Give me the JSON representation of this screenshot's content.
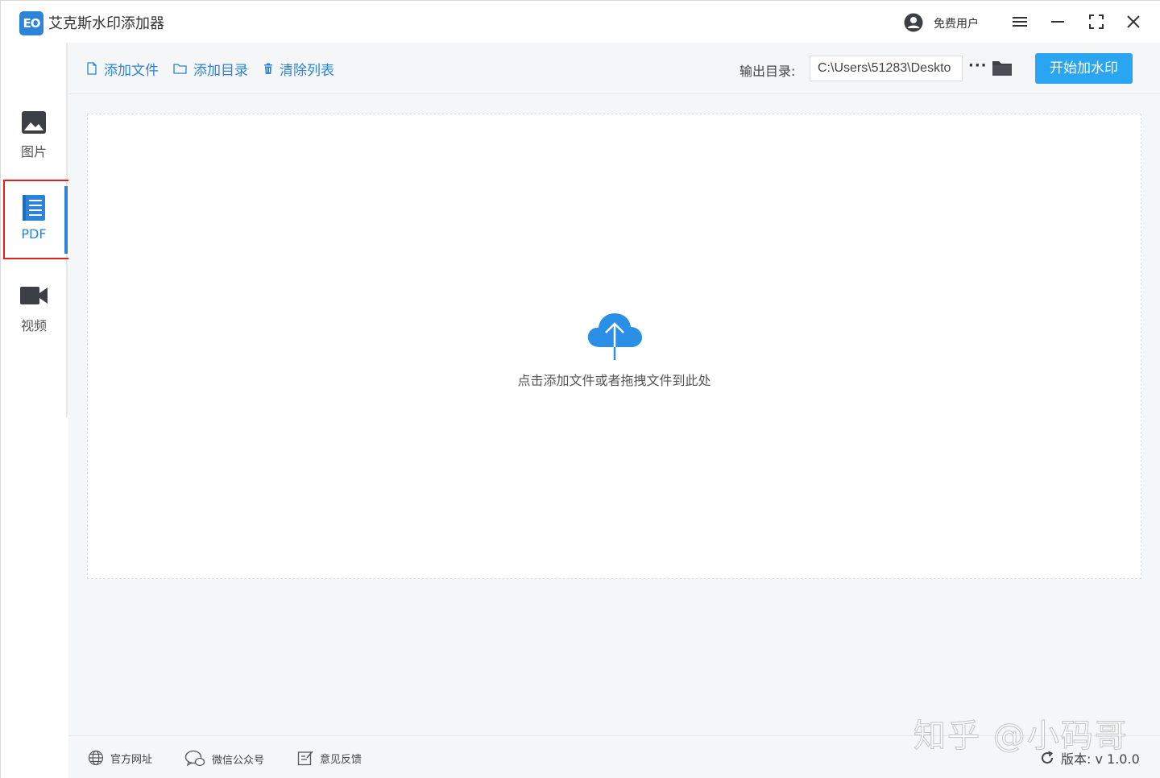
{
  "app": {
    "title": "艾克斯水印添加器",
    "logo_text": "EO",
    "user_label": "免费用户"
  },
  "sidebar": {
    "items": [
      {
        "label": "图片",
        "icon": "image-icon"
      },
      {
        "label": "PDF",
        "icon": "document-icon",
        "active": true
      },
      {
        "label": "视频",
        "icon": "video-camera-icon"
      }
    ]
  },
  "toolbar": {
    "add_file": "添加文件",
    "add_dir": "添加目录",
    "clear_list": "清除列表",
    "output_label": "输出目录:",
    "output_value": "C:\\Users\\51283\\Deskto",
    "more": "···",
    "start": "开始加水印"
  },
  "dropzone": {
    "hint": "点击添加文件或者拖拽文件到此处"
  },
  "footer": {
    "site": "官方网址",
    "wechat": "微信公众号",
    "feedback": "意见反馈",
    "version": "版本: v 1.0.0"
  },
  "watermark": "知乎 @小码哥",
  "colors": {
    "accent": "#2b84d8",
    "button": "#2aa5f2",
    "highlight": "#e02020",
    "background": "#f5f6f8"
  }
}
